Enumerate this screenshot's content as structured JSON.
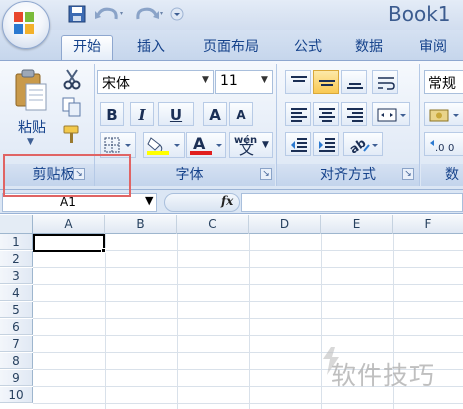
{
  "window": {
    "title": "Book1"
  },
  "tabs": [
    {
      "label": "开始",
      "active": true
    },
    {
      "label": "插入"
    },
    {
      "label": "页面布局"
    },
    {
      "label": "公式"
    },
    {
      "label": "数据"
    },
    {
      "label": "审阅"
    }
  ],
  "ribbon": {
    "clipboard": {
      "paste_label": "粘贴",
      "group_label": "剪贴板"
    },
    "font": {
      "font_name": "宋体",
      "font_size": "11",
      "group_label": "字体",
      "bold": "B",
      "italic": "I",
      "underline": "U",
      "grow": "A",
      "shrink": "A",
      "phonetic": "wén",
      "phonetic_char": "文"
    },
    "alignment": {
      "group_label": "对齐方式"
    },
    "number": {
      "format": "常规",
      "group_label": "数"
    }
  },
  "formula_bar": {
    "name_box": "A1",
    "fx": "fx",
    "value": ""
  },
  "grid": {
    "columns": [
      "A",
      "B",
      "C",
      "D",
      "E",
      "F"
    ],
    "rows": [
      "1",
      "2",
      "3",
      "4",
      "5",
      "6",
      "7",
      "8",
      "9",
      "10"
    ],
    "active_cell": "A1"
  },
  "watermark": {
    "text": "软件技巧"
  },
  "colors": {
    "accent": "#15428b",
    "highlight_box": "#e06464",
    "selected_align": "#f9c952"
  }
}
